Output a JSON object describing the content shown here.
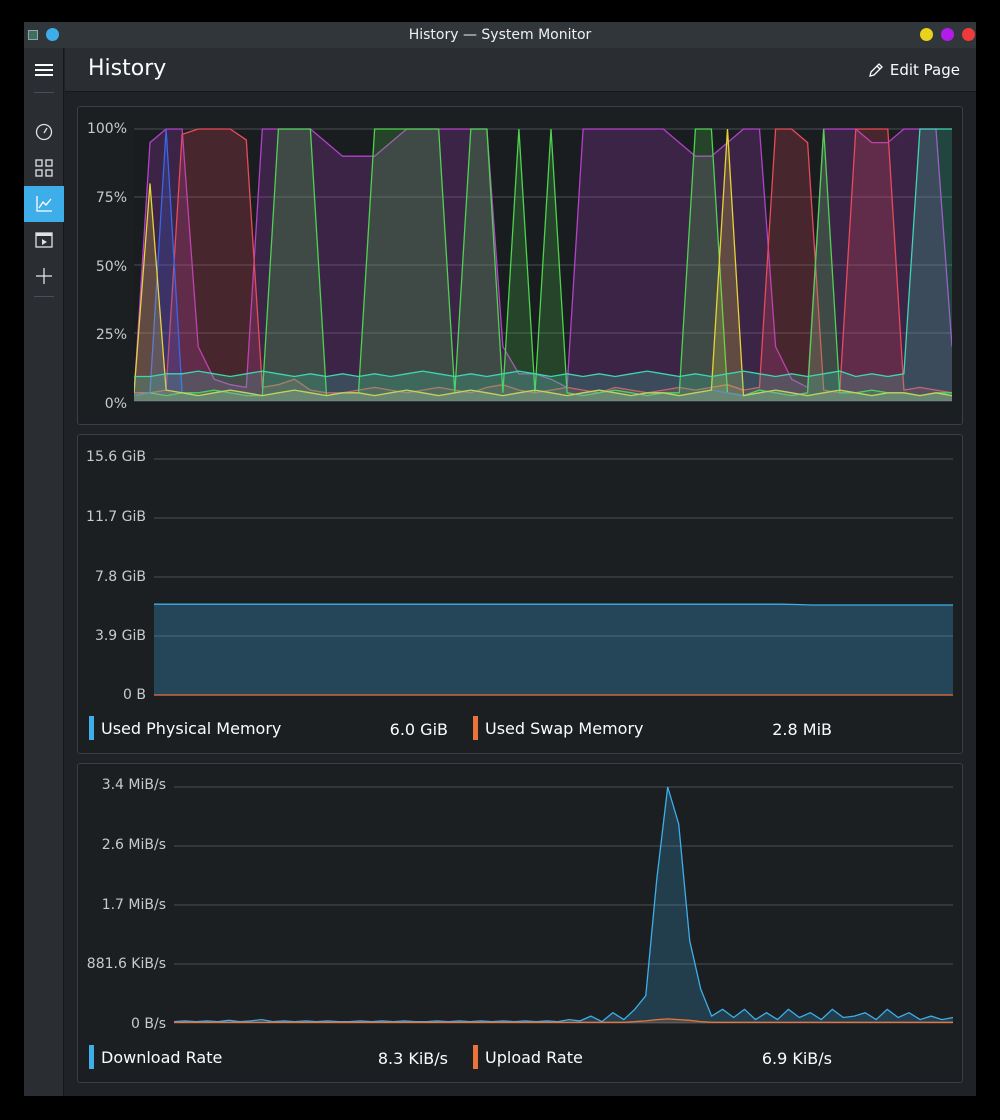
{
  "window": {
    "title": "History — System Monitor",
    "buttons": [
      {
        "name": "minimize-button",
        "color": "#e8d21c"
      },
      {
        "name": "maximize-button",
        "color": "#b31ce8"
      },
      {
        "name": "close-button",
        "color": "#ee3a3a"
      }
    ]
  },
  "sidebar": {
    "items": [
      {
        "name": "overview",
        "icon": "gauge-icon",
        "active": false
      },
      {
        "name": "applications",
        "icon": "grid-icon",
        "active": false
      },
      {
        "name": "history",
        "icon": "chart-icon",
        "active": true
      },
      {
        "name": "processes",
        "icon": "window-play-icon",
        "active": false
      },
      {
        "name": "add-page",
        "icon": "plus-icon",
        "active": false
      }
    ]
  },
  "header": {
    "title": "History",
    "edit_label": "Edit Page"
  },
  "colors": {
    "accent": "#3daee9",
    "upload": "#e8743b",
    "grid": "#4a4f55"
  },
  "chart_data": [
    {
      "type": "area",
      "name": "cpu-history",
      "yticks": [
        "100%",
        "75%",
        "50%",
        "25%",
        "0%"
      ],
      "ylim": [
        0,
        100
      ],
      "series": [
        {
          "color": "#b341c8",
          "values": [
            2,
            95,
            100,
            100,
            20,
            8,
            6,
            5,
            100,
            100,
            100,
            100,
            95,
            90,
            90,
            90,
            95,
            100,
            100,
            100,
            100,
            100,
            100,
            20,
            10,
            10,
            8,
            5,
            100,
            100,
            100,
            100,
            100,
            100,
            95,
            90,
            90,
            95,
            100,
            100,
            20,
            8,
            5,
            100,
            100,
            100,
            95,
            95,
            100,
            100,
            100,
            20
          ]
        },
        {
          "color": "#e84a5a",
          "values": [
            3,
            3,
            4,
            98,
            100,
            100,
            100,
            96,
            5,
            6,
            8,
            4,
            3,
            3,
            4,
            5,
            4,
            3,
            4,
            5,
            4,
            3,
            5,
            6,
            4,
            3,
            4,
            5,
            4,
            3,
            5,
            4,
            3,
            4,
            5,
            4,
            5,
            6,
            4,
            5,
            100,
            100,
            95,
            4,
            3,
            100,
            100,
            100,
            4,
            5,
            4,
            3
          ]
        },
        {
          "color": "#4ed34e",
          "values": [
            2,
            3,
            2,
            3,
            3,
            4,
            3,
            2,
            2,
            100,
            100,
            100,
            2,
            3,
            3,
            100,
            100,
            100,
            100,
            100,
            3,
            100,
            100,
            3,
            100,
            3,
            100,
            3,
            2,
            3,
            4,
            3,
            2,
            3,
            3,
            100,
            100,
            3,
            2,
            4,
            3,
            2,
            3,
            100,
            3,
            3,
            4,
            3,
            3,
            2,
            3,
            3
          ]
        },
        {
          "color": "#3a66e8",
          "values": [
            2,
            3,
            100,
            3,
            2,
            3,
            4,
            3,
            2,
            3,
            4,
            3,
            2,
            3,
            3,
            2,
            3,
            4,
            3,
            2,
            3,
            4,
            3,
            2,
            3,
            4,
            3,
            2,
            3,
            4,
            3,
            2,
            3,
            3,
            2,
            3,
            4,
            3,
            2,
            3,
            4,
            3,
            2,
            3,
            4,
            3,
            2,
            3,
            3,
            2,
            3,
            2
          ]
        },
        {
          "color": "#e8d23a",
          "values": [
            3,
            80,
            4,
            3,
            2,
            3,
            4,
            3,
            2,
            3,
            4,
            3,
            2,
            3,
            3,
            2,
            3,
            4,
            3,
            2,
            3,
            4,
            3,
            2,
            3,
            4,
            3,
            2,
            3,
            4,
            3,
            2,
            3,
            3,
            2,
            3,
            4,
            100,
            2,
            3,
            4,
            3,
            2,
            3,
            4,
            3,
            2,
            3,
            3,
            2,
            3,
            2
          ]
        },
        {
          "color": "#3ed6b0",
          "values": [
            9,
            9,
            10,
            10,
            11,
            10,
            9,
            10,
            11,
            10,
            9,
            10,
            9,
            10,
            9,
            10,
            9,
            10,
            11,
            10,
            9,
            10,
            9,
            10,
            11,
            10,
            9,
            10,
            9,
            10,
            9,
            10,
            11,
            10,
            9,
            10,
            9,
            10,
            11,
            10,
            9,
            10,
            9,
            10,
            11,
            9,
            10,
            9,
            10,
            100,
            100,
            100
          ]
        }
      ]
    },
    {
      "type": "area",
      "name": "memory-history",
      "yticks": [
        "15.6 GiB",
        "11.7 GiB",
        "7.8 GiB",
        "3.9 GiB",
        "0 B"
      ],
      "ylim": [
        0,
        15.6
      ],
      "series": [
        {
          "color": "#3daee9",
          "values": [
            6.0,
            6.0,
            6.0,
            6.0,
            6.0,
            6.0,
            6.0,
            6.0,
            6.0,
            6.0,
            6.0,
            6.0,
            6.0,
            6.0,
            6.0,
            6.0,
            6.0,
            6.0,
            6.0,
            6.0,
            6.0,
            6.0,
            6.0,
            6.0,
            6.0,
            6.0,
            6.0,
            6.0,
            6.0,
            6.0,
            6.0,
            6.0,
            6.0,
            6.0,
            6.0,
            6.0,
            6.0,
            6.0,
            6.0,
            6.0,
            6.0,
            5.98,
            5.95,
            5.95,
            5.95,
            5.95,
            5.95,
            5.95,
            5.95,
            5.95,
            5.95,
            5.95
          ]
        },
        {
          "color": "#e8743b",
          "values": [
            0.003,
            0.003,
            0.003,
            0.003,
            0.003,
            0.003,
            0.003,
            0.003,
            0.003,
            0.003,
            0.003,
            0.003,
            0.003,
            0.003,
            0.003,
            0.003,
            0.003,
            0.003,
            0.003,
            0.003,
            0.003,
            0.003,
            0.003,
            0.003,
            0.003,
            0.003,
            0.003,
            0.003,
            0.003,
            0.003,
            0.003,
            0.003,
            0.003,
            0.003,
            0.003,
            0.003,
            0.003,
            0.003,
            0.003,
            0.003,
            0.003,
            0.003,
            0.003,
            0.003,
            0.003,
            0.003,
            0.003,
            0.003,
            0.003,
            0.003,
            0.003,
            0.003
          ]
        }
      ],
      "legend": [
        {
          "label": "Used Physical Memory",
          "value": "6.0 GiB",
          "color": "#3daee9"
        },
        {
          "label": "Used Swap Memory",
          "value": "2.8 MiB",
          "color": "#e8743b"
        }
      ]
    },
    {
      "type": "area",
      "name": "network-history",
      "yticks": [
        "3.4 MiB/s",
        "2.6 MiB/s",
        "1.7 MiB/s",
        "881.6 KiB/s",
        "0 B/s"
      ],
      "ylim": [
        0,
        3.44
      ],
      "series": [
        {
          "color": "#3daee9",
          "values": [
            0.02,
            0.03,
            0.02,
            0.03,
            0.02,
            0.04,
            0.02,
            0.03,
            0.05,
            0.02,
            0.03,
            0.02,
            0.03,
            0.02,
            0.03,
            0.02,
            0.02,
            0.03,
            0.02,
            0.03,
            0.02,
            0.03,
            0.02,
            0.02,
            0.03,
            0.02,
            0.03,
            0.02,
            0.03,
            0.02,
            0.03,
            0.02,
            0.03,
            0.02,
            0.03,
            0.02,
            0.05,
            0.03,
            0.1,
            0.02,
            0.15,
            0.05,
            0.2,
            0.4,
            2.1,
            3.44,
            2.9,
            1.2,
            0.5,
            0.1,
            0.2,
            0.08,
            0.2,
            0.05,
            0.15,
            0.05,
            0.2,
            0.08,
            0.15,
            0.05,
            0.2,
            0.08,
            0.1,
            0.15,
            0.05,
            0.2,
            0.08,
            0.15,
            0.05,
            0.1,
            0.05,
            0.08
          ]
        },
        {
          "color": "#e8743b",
          "values": [
            0.01,
            0.01,
            0.01,
            0.01,
            0.01,
            0.01,
            0.01,
            0.01,
            0.01,
            0.01,
            0.01,
            0.01,
            0.01,
            0.01,
            0.01,
            0.01,
            0.01,
            0.01,
            0.01,
            0.01,
            0.01,
            0.01,
            0.01,
            0.01,
            0.01,
            0.01,
            0.01,
            0.01,
            0.01,
            0.01,
            0.01,
            0.01,
            0.01,
            0.01,
            0.01,
            0.01,
            0.01,
            0.01,
            0.01,
            0.01,
            0.01,
            0.01,
            0.02,
            0.03,
            0.05,
            0.06,
            0.05,
            0.04,
            0.02,
            0.01,
            0.01,
            0.01,
            0.01,
            0.01,
            0.01,
            0.01,
            0.01,
            0.01,
            0.01,
            0.01,
            0.01,
            0.01,
            0.01,
            0.01,
            0.01,
            0.01,
            0.01,
            0.01,
            0.01,
            0.01,
            0.01,
            0.01
          ]
        }
      ],
      "legend": [
        {
          "label": "Download Rate",
          "value": "8.3 KiB/s",
          "color": "#3daee9"
        },
        {
          "label": "Upload Rate",
          "value": "6.9 KiB/s",
          "color": "#e8743b"
        }
      ]
    }
  ]
}
